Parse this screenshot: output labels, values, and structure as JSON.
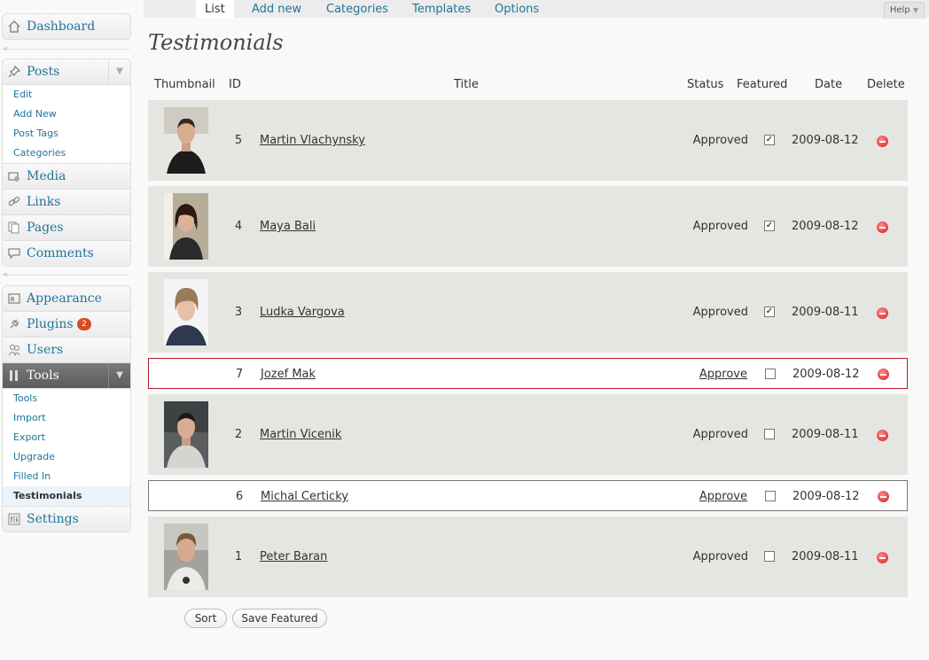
{
  "sidebar": {
    "dashboard": "Dashboard",
    "posts": "Posts",
    "posts_sub": [
      "Edit",
      "Add New",
      "Post Tags",
      "Categories"
    ],
    "media": "Media",
    "links": "Links",
    "pages": "Pages",
    "comments": "Comments",
    "appearance": "Appearance",
    "plugins": "Plugins",
    "plugins_count": "2",
    "users": "Users",
    "tools": "Tools",
    "tools_sub": [
      "Tools",
      "Import",
      "Export",
      "Upgrade",
      "Filled In",
      "Testimonials"
    ],
    "settings": "Settings"
  },
  "tabs": [
    "List",
    "Add new",
    "Categories",
    "Templates",
    "Options"
  ],
  "help": "Help",
  "page_title": "Testimonials",
  "columns": [
    "Thumbnail",
    "ID",
    "Title",
    "Status",
    "Featured",
    "Date",
    "Delete"
  ],
  "rows": [
    {
      "id": "5",
      "title": "Martin Vlachynsky",
      "status": "Approved",
      "featured": true,
      "date": "2009-08-12"
    },
    {
      "id": "4",
      "title": "Maya Bali",
      "status": "Approved",
      "featured": true,
      "date": "2009-08-12"
    },
    {
      "id": "3",
      "title": "Ludka Vargova",
      "status": "Approved",
      "featured": true,
      "date": "2009-08-11"
    },
    {
      "id": "7",
      "title": "Jozef Mak",
      "status": "Approve",
      "featured": false,
      "date": "2009-08-12"
    },
    {
      "id": "2",
      "title": "Martin Vicenik",
      "status": "Approved",
      "featured": false,
      "date": "2009-08-11"
    },
    {
      "id": "6",
      "title": "Michal Certicky",
      "status": "Approve",
      "featured": false,
      "date": "2009-08-12"
    },
    {
      "id": "1",
      "title": "Peter Baran",
      "status": "Approved",
      "featured": false,
      "date": "2009-08-11"
    }
  ],
  "buttons": {
    "sort": "Sort",
    "save_featured": "Save Featured"
  },
  "colors": {
    "link": "#21759b",
    "row_bg": "#e4e6e2",
    "pending_border": "#b51d2d",
    "delete": "#d21e1e"
  }
}
